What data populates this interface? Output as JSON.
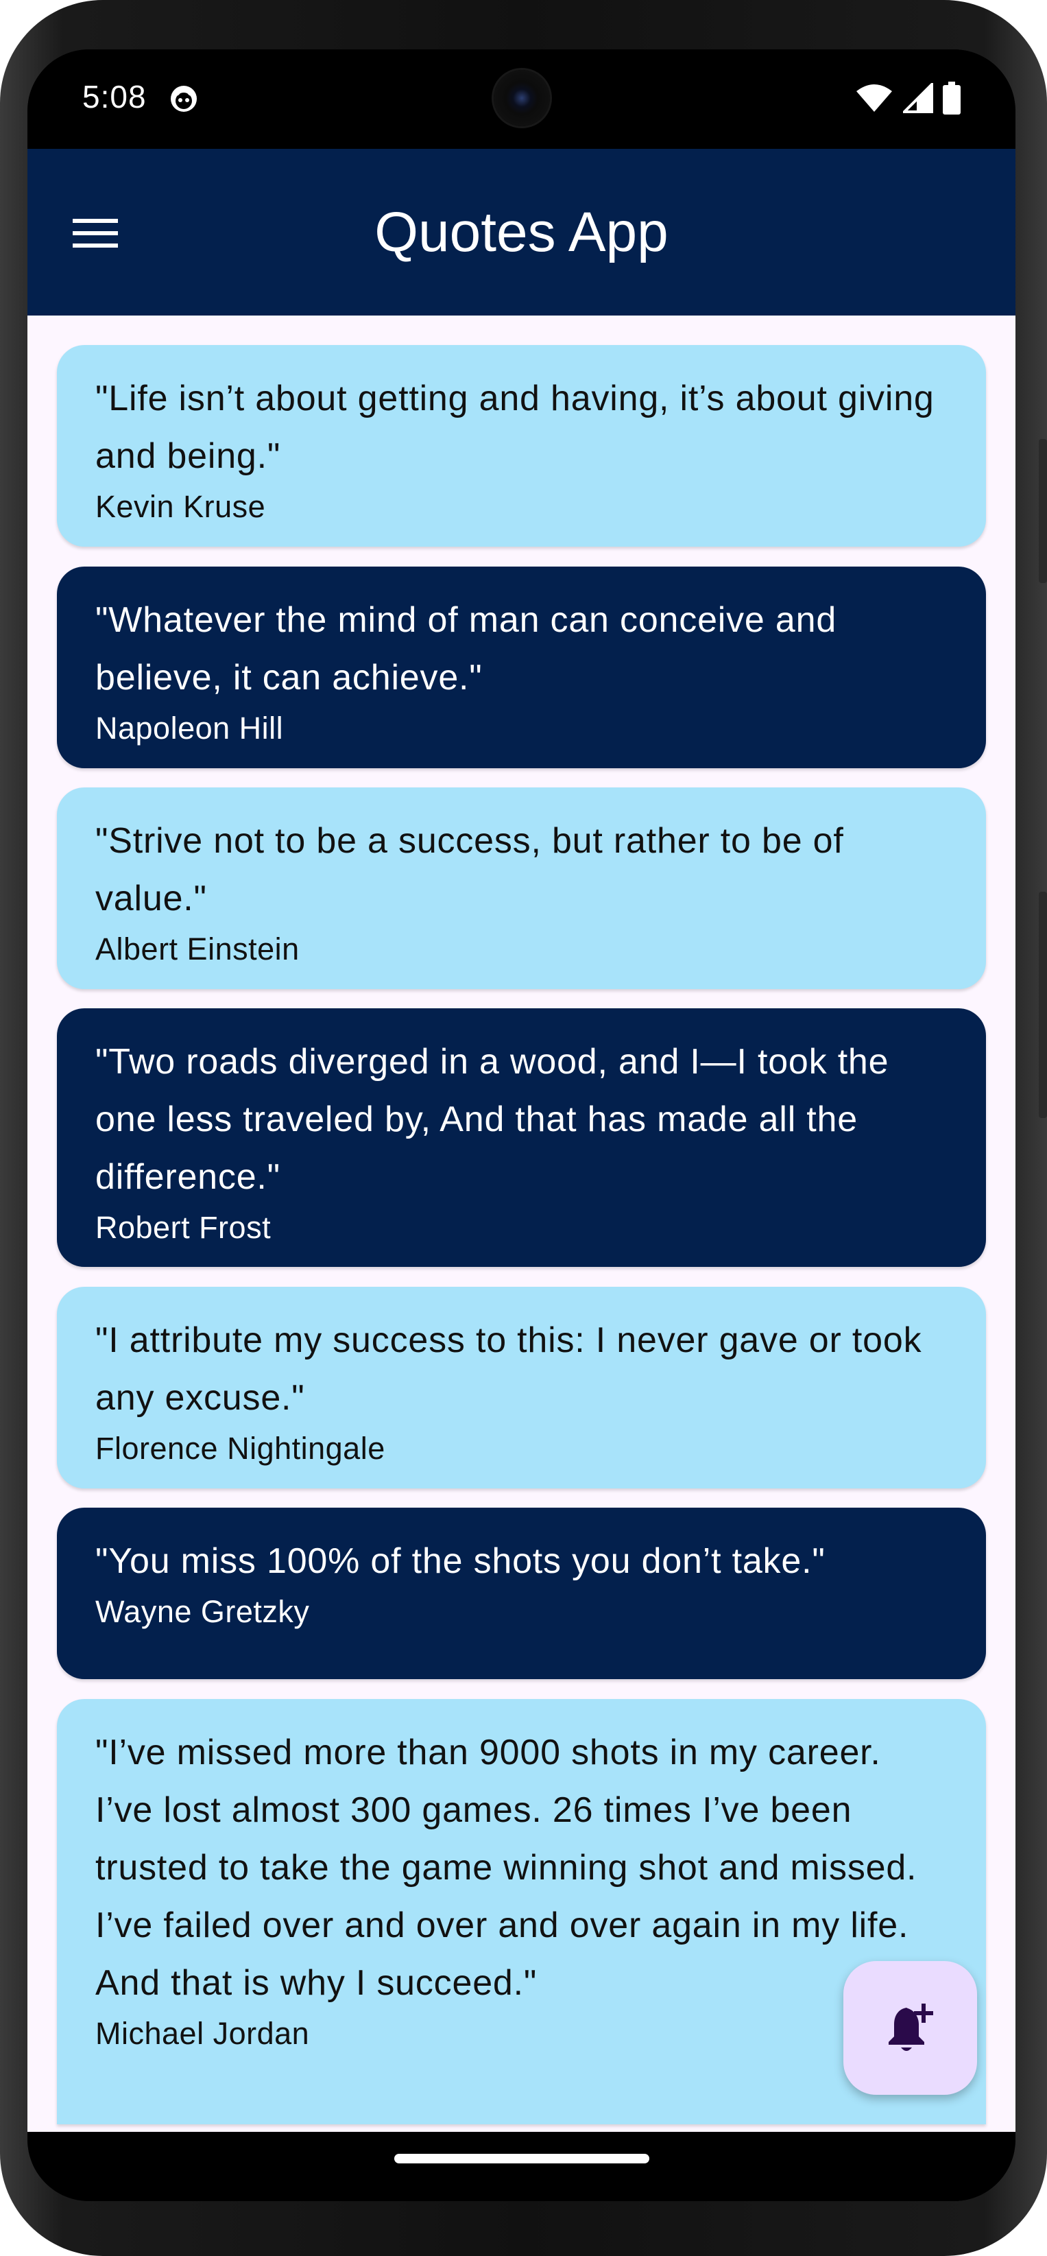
{
  "status_bar": {
    "time": "5:08",
    "icons": [
      "notification-app-icon",
      "wifi-icon",
      "cell-signal-icon",
      "battery-icon"
    ]
  },
  "app_bar": {
    "title": "Quotes App",
    "menu_icon": "menu-icon"
  },
  "colors": {
    "app_bar": "#03204d",
    "card_light": "#a8e3fa",
    "card_dark": "#03204d",
    "background": "#fdf6ff",
    "fab": "#eadcff",
    "fab_icon": "#2a0a4a"
  },
  "quotes": [
    {
      "text": "\"Life isn’t about getting and having, it’s about giving and being.\"",
      "author": "Kevin Kruse",
      "style": "light"
    },
    {
      "text": "\"Whatever the mind of man can conceive and believe, it can achieve.\"",
      "author": "Napoleon Hill",
      "style": "dark"
    },
    {
      "text": "\"Strive not to be a success, but rather to be of value.\"",
      "author": "Albert Einstein",
      "style": "light"
    },
    {
      "text": "\"Two roads diverged in a wood, and I—I took the one less traveled by, And that has made all the difference.\"",
      "author": "Robert Frost",
      "style": "dark"
    },
    {
      "text": "\"I attribute my success to this: I never gave or took any excuse.\"",
      "author": "Florence Nightingale",
      "style": "light"
    },
    {
      "text": "\"You miss 100% of the shots you don’t take.\"",
      "author": "Wayne Gretzky",
      "style": "dark"
    },
    {
      "text": "\"I’ve missed more than 9000 shots in my career. I’ve lost almost 300 games. 26 times I’ve been trusted to take the game winning shot and missed. I’ve failed over and over and over again in my life. And that is why I succeed.\"",
      "author": "Michael Jordan",
      "style": "light"
    }
  ],
  "fab": {
    "icon": "add-notification-bell-icon"
  }
}
